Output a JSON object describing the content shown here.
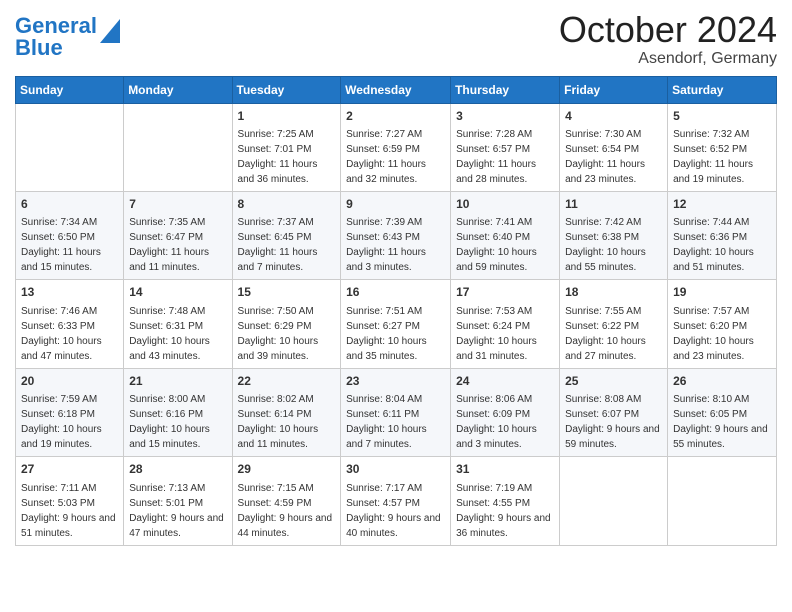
{
  "header": {
    "logo_general": "General",
    "logo_blue": "Blue",
    "month_title": "October 2024",
    "location": "Asendorf, Germany"
  },
  "weekdays": [
    "Sunday",
    "Monday",
    "Tuesday",
    "Wednesday",
    "Thursday",
    "Friday",
    "Saturday"
  ],
  "weeks": [
    [
      {
        "day": "",
        "sunrise": "",
        "sunset": "",
        "daylight": ""
      },
      {
        "day": "",
        "sunrise": "",
        "sunset": "",
        "daylight": ""
      },
      {
        "day": "1",
        "sunrise": "Sunrise: 7:25 AM",
        "sunset": "Sunset: 7:01 PM",
        "daylight": "Daylight: 11 hours and 36 minutes."
      },
      {
        "day": "2",
        "sunrise": "Sunrise: 7:27 AM",
        "sunset": "Sunset: 6:59 PM",
        "daylight": "Daylight: 11 hours and 32 minutes."
      },
      {
        "day": "3",
        "sunrise": "Sunrise: 7:28 AM",
        "sunset": "Sunset: 6:57 PM",
        "daylight": "Daylight: 11 hours and 28 minutes."
      },
      {
        "day": "4",
        "sunrise": "Sunrise: 7:30 AM",
        "sunset": "Sunset: 6:54 PM",
        "daylight": "Daylight: 11 hours and 23 minutes."
      },
      {
        "day": "5",
        "sunrise": "Sunrise: 7:32 AM",
        "sunset": "Sunset: 6:52 PM",
        "daylight": "Daylight: 11 hours and 19 minutes."
      }
    ],
    [
      {
        "day": "6",
        "sunrise": "Sunrise: 7:34 AM",
        "sunset": "Sunset: 6:50 PM",
        "daylight": "Daylight: 11 hours and 15 minutes."
      },
      {
        "day": "7",
        "sunrise": "Sunrise: 7:35 AM",
        "sunset": "Sunset: 6:47 PM",
        "daylight": "Daylight: 11 hours and 11 minutes."
      },
      {
        "day": "8",
        "sunrise": "Sunrise: 7:37 AM",
        "sunset": "Sunset: 6:45 PM",
        "daylight": "Daylight: 11 hours and 7 minutes."
      },
      {
        "day": "9",
        "sunrise": "Sunrise: 7:39 AM",
        "sunset": "Sunset: 6:43 PM",
        "daylight": "Daylight: 11 hours and 3 minutes."
      },
      {
        "day": "10",
        "sunrise": "Sunrise: 7:41 AM",
        "sunset": "Sunset: 6:40 PM",
        "daylight": "Daylight: 10 hours and 59 minutes."
      },
      {
        "day": "11",
        "sunrise": "Sunrise: 7:42 AM",
        "sunset": "Sunset: 6:38 PM",
        "daylight": "Daylight: 10 hours and 55 minutes."
      },
      {
        "day": "12",
        "sunrise": "Sunrise: 7:44 AM",
        "sunset": "Sunset: 6:36 PM",
        "daylight": "Daylight: 10 hours and 51 minutes."
      }
    ],
    [
      {
        "day": "13",
        "sunrise": "Sunrise: 7:46 AM",
        "sunset": "Sunset: 6:33 PM",
        "daylight": "Daylight: 10 hours and 47 minutes."
      },
      {
        "day": "14",
        "sunrise": "Sunrise: 7:48 AM",
        "sunset": "Sunset: 6:31 PM",
        "daylight": "Daylight: 10 hours and 43 minutes."
      },
      {
        "day": "15",
        "sunrise": "Sunrise: 7:50 AM",
        "sunset": "Sunset: 6:29 PM",
        "daylight": "Daylight: 10 hours and 39 minutes."
      },
      {
        "day": "16",
        "sunrise": "Sunrise: 7:51 AM",
        "sunset": "Sunset: 6:27 PM",
        "daylight": "Daylight: 10 hours and 35 minutes."
      },
      {
        "day": "17",
        "sunrise": "Sunrise: 7:53 AM",
        "sunset": "Sunset: 6:24 PM",
        "daylight": "Daylight: 10 hours and 31 minutes."
      },
      {
        "day": "18",
        "sunrise": "Sunrise: 7:55 AM",
        "sunset": "Sunset: 6:22 PM",
        "daylight": "Daylight: 10 hours and 27 minutes."
      },
      {
        "day": "19",
        "sunrise": "Sunrise: 7:57 AM",
        "sunset": "Sunset: 6:20 PM",
        "daylight": "Daylight: 10 hours and 23 minutes."
      }
    ],
    [
      {
        "day": "20",
        "sunrise": "Sunrise: 7:59 AM",
        "sunset": "Sunset: 6:18 PM",
        "daylight": "Daylight: 10 hours and 19 minutes."
      },
      {
        "day": "21",
        "sunrise": "Sunrise: 8:00 AM",
        "sunset": "Sunset: 6:16 PM",
        "daylight": "Daylight: 10 hours and 15 minutes."
      },
      {
        "day": "22",
        "sunrise": "Sunrise: 8:02 AM",
        "sunset": "Sunset: 6:14 PM",
        "daylight": "Daylight: 10 hours and 11 minutes."
      },
      {
        "day": "23",
        "sunrise": "Sunrise: 8:04 AM",
        "sunset": "Sunset: 6:11 PM",
        "daylight": "Daylight: 10 hours and 7 minutes."
      },
      {
        "day": "24",
        "sunrise": "Sunrise: 8:06 AM",
        "sunset": "Sunset: 6:09 PM",
        "daylight": "Daylight: 10 hours and 3 minutes."
      },
      {
        "day": "25",
        "sunrise": "Sunrise: 8:08 AM",
        "sunset": "Sunset: 6:07 PM",
        "daylight": "Daylight: 9 hours and 59 minutes."
      },
      {
        "day": "26",
        "sunrise": "Sunrise: 8:10 AM",
        "sunset": "Sunset: 6:05 PM",
        "daylight": "Daylight: 9 hours and 55 minutes."
      }
    ],
    [
      {
        "day": "27",
        "sunrise": "Sunrise: 7:11 AM",
        "sunset": "Sunset: 5:03 PM",
        "daylight": "Daylight: 9 hours and 51 minutes."
      },
      {
        "day": "28",
        "sunrise": "Sunrise: 7:13 AM",
        "sunset": "Sunset: 5:01 PM",
        "daylight": "Daylight: 9 hours and 47 minutes."
      },
      {
        "day": "29",
        "sunrise": "Sunrise: 7:15 AM",
        "sunset": "Sunset: 4:59 PM",
        "daylight": "Daylight: 9 hours and 44 minutes."
      },
      {
        "day": "30",
        "sunrise": "Sunrise: 7:17 AM",
        "sunset": "Sunset: 4:57 PM",
        "daylight": "Daylight: 9 hours and 40 minutes."
      },
      {
        "day": "31",
        "sunrise": "Sunrise: 7:19 AM",
        "sunset": "Sunset: 4:55 PM",
        "daylight": "Daylight: 9 hours and 36 minutes."
      },
      {
        "day": "",
        "sunrise": "",
        "sunset": "",
        "daylight": ""
      },
      {
        "day": "",
        "sunrise": "",
        "sunset": "",
        "daylight": ""
      }
    ]
  ]
}
